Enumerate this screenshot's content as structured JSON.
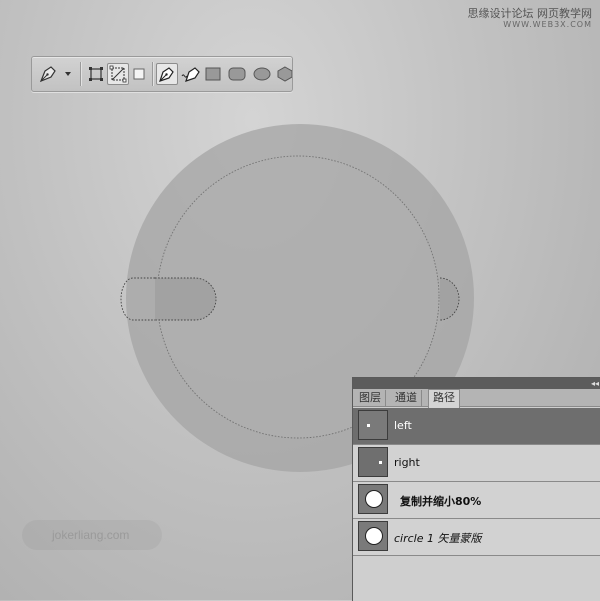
{
  "watermark": {
    "forum": "思缘设计论坛",
    "site": "网页教学网",
    "url": "WWW.WEB3X.COM"
  },
  "toolbar": {
    "tools": [
      {
        "name": "pen-tool-preset",
        "active": false
      },
      {
        "name": "shape-layers",
        "active": false
      },
      {
        "name": "paths",
        "active": true
      },
      {
        "name": "fill-pixels",
        "active": false
      },
      {
        "name": "pen-tool",
        "active": true
      },
      {
        "name": "freeform-pen-tool",
        "active": false
      },
      {
        "name": "rectangle-tool",
        "active": false
      },
      {
        "name": "rounded-rectangle-tool",
        "active": false
      },
      {
        "name": "ellipse-tool",
        "active": false
      },
      {
        "name": "polygon-tool",
        "active": false
      }
    ]
  },
  "canvas": {
    "logo_text": "jokerliang.com"
  },
  "paths_panel": {
    "tabs": [
      {
        "label": "图层",
        "active": false
      },
      {
        "label": "通道",
        "active": false
      },
      {
        "label": "路径",
        "active": true
      }
    ],
    "rows": [
      {
        "label": "left",
        "selected": true,
        "thumb": "dot"
      },
      {
        "label": "right",
        "selected": false,
        "thumb": "dot"
      },
      {
        "label": "复制并缩小80%",
        "selected": false,
        "thumb": "circle",
        "style": "bold"
      },
      {
        "label": "circle 1 矢量蒙版",
        "selected": false,
        "thumb": "circle",
        "style": "italic"
      }
    ]
  }
}
